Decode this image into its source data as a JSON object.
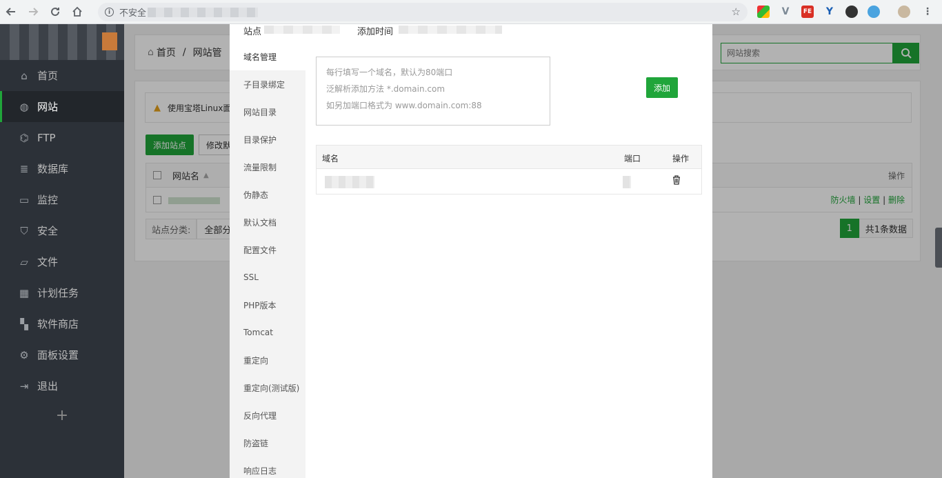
{
  "browser": {
    "security_label": "不安全",
    "back_icon": "arrow-left-icon",
    "forward_icon": "arrow-right-icon",
    "reload_icon": "reload-icon",
    "home_icon": "home-icon",
    "star_icon": "star-icon",
    "extensions": [
      {
        "name": "ext-colorful",
        "color": "#3b7bd8",
        "label": ""
      },
      {
        "name": "ext-v",
        "color": "#7d8a96",
        "label": "V"
      },
      {
        "name": "ext-fe",
        "color": "#d93025",
        "label": "FE"
      },
      {
        "name": "ext-y",
        "color": "#1a5fb4",
        "label": "Y"
      },
      {
        "name": "ext-circle",
        "color": "#333333",
        "label": ""
      },
      {
        "name": "ext-blue",
        "color": "#4aa3df",
        "label": ""
      }
    ]
  },
  "sidebar": {
    "items": [
      {
        "label": "首页",
        "icon": "home-icon"
      },
      {
        "label": "网站",
        "icon": "globe-icon"
      },
      {
        "label": "FTP",
        "icon": "ftp-icon"
      },
      {
        "label": "数据库",
        "icon": "database-icon"
      },
      {
        "label": "监控",
        "icon": "monitor-icon"
      },
      {
        "label": "安全",
        "icon": "shield-icon"
      },
      {
        "label": "文件",
        "icon": "folder-icon"
      },
      {
        "label": "计划任务",
        "icon": "calendar-icon"
      },
      {
        "label": "软件商店",
        "icon": "grid-icon"
      },
      {
        "label": "面板设置",
        "icon": "gear-icon"
      },
      {
        "label": "退出",
        "icon": "logout-icon"
      }
    ],
    "active_index": 1,
    "add_label": "+"
  },
  "main": {
    "breadcrumb_home": "首页",
    "breadcrumb_sep": "/",
    "breadcrumb_current": "网站管",
    "search_placeholder": "网站搜索",
    "warning_text": "使用宝塔Linux面",
    "add_site": "添加站点",
    "modify": "修改默",
    "col_site_name": "网站名",
    "col_ops": "操作",
    "row_ops": {
      "firewall": "防火墙",
      "sep": "|",
      "settings": "设置",
      "delete": "删除"
    },
    "category_label": "站点分类:",
    "category_value": "全部分",
    "page_num": "1",
    "page_total": "共1条数据"
  },
  "modal": {
    "top_site": "站点",
    "top_added": "添加时间",
    "tabs": [
      "域名管理",
      "子目录绑定",
      "网站目录",
      "目录保护",
      "流量限制",
      "伪静态",
      "默认文档",
      "配置文件",
      "SSL",
      "PHP版本",
      "Tomcat",
      "重定向",
      "重定向(测试版)",
      "反向代理",
      "防盗链",
      "响应日志"
    ],
    "active_tab": 0,
    "textarea_lines": [
      "每行填写一个域名，默认为80端口",
      "泛解析添加方法 *.domain.com",
      "如另加端口格式为 www.domain.com:88"
    ],
    "add_button": "添加",
    "table_headers": {
      "domain": "域名",
      "port": "端口",
      "ops": "操作"
    }
  }
}
